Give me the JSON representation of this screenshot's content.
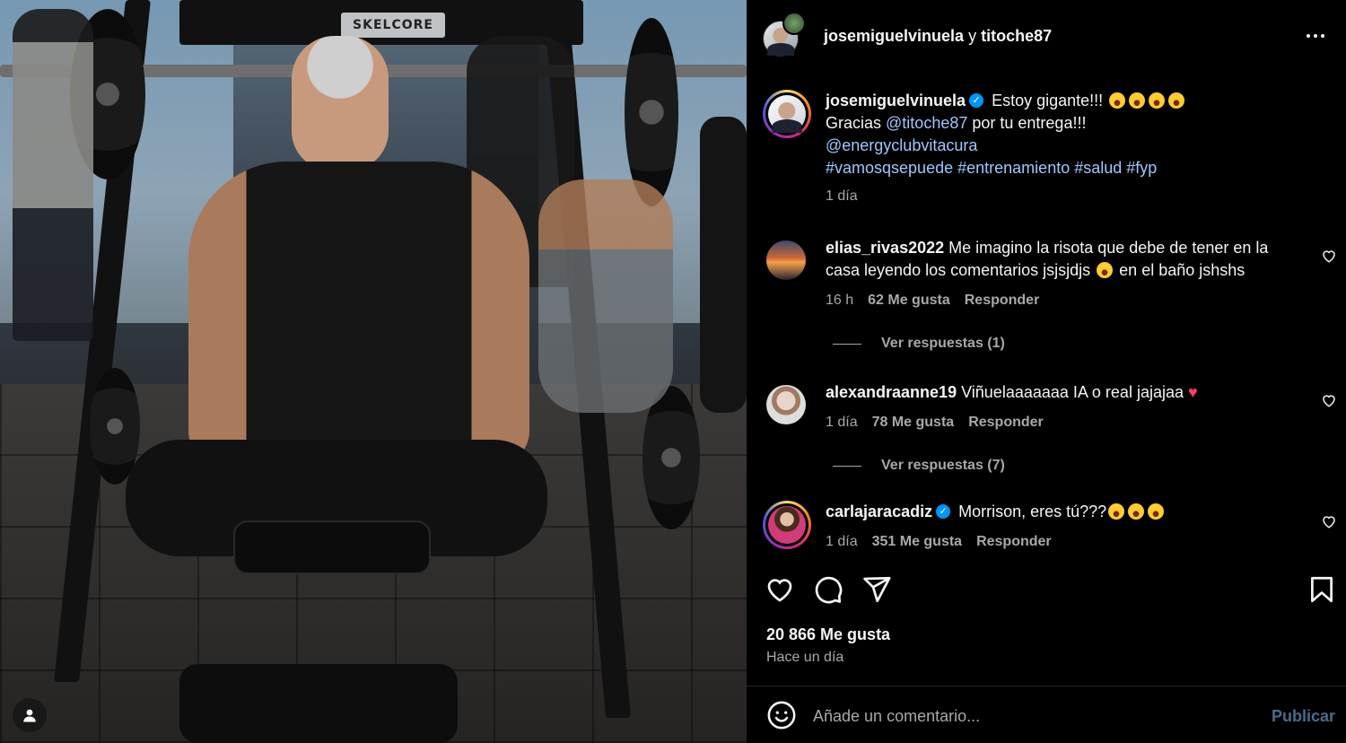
{
  "photo": {
    "brand_text": "SKELCORE"
  },
  "header": {
    "user1": "josemiguelvinuela",
    "joiner": "y",
    "user2": "titoche87"
  },
  "caption": {
    "username": "josemiguelvinuela",
    "line1_text": "Estoy gigante!!!",
    "line2_prefix": "Gracias",
    "line2_mention": "@titoche87",
    "line2_suffix": "por tu entrega!!!",
    "line3_mention": "@energyclubvitacura",
    "hashtags": [
      "#vamosqsepuede",
      "#entrenamiento",
      "#salud",
      "#fyp"
    ],
    "time": "1 día"
  },
  "comments": [
    {
      "username": "elias_rivas2022",
      "text_a": "Me imagino la risota que debe de tener en la casa leyendo los comentarios jsjsjdjs",
      "text_b": "en el baño jshshs",
      "time": "16 h",
      "likes": "62 Me gusta",
      "reply": "Responder",
      "view_replies": "Ver respuestas (1)"
    },
    {
      "username": "alexandraanne19",
      "text_a": "Viñuelaaaaaaa IA o real jajajaa",
      "time": "1 día",
      "likes": "78 Me gusta",
      "reply": "Responder",
      "view_replies": "Ver respuestas (7)"
    },
    {
      "username": "carlajaracadiz",
      "text_a": "Morrison, eres tú???",
      "time": "1 día",
      "likes": "351 Me gusta",
      "reply": "Responder"
    }
  ],
  "likes_total": "20 866 Me gusta",
  "posted": "Hace un día",
  "composer": {
    "placeholder": "Añade un comentario...",
    "publish": "Publicar"
  },
  "icons": {
    "more": "more-options-icon",
    "like": "heart-icon",
    "comment": "comment-icon",
    "share": "send-icon",
    "save": "bookmark-icon",
    "emoji": "emoji-icon",
    "verified": "verified-badge-icon",
    "user": "user-icon"
  },
  "colors": {
    "accent_link": "#9fc6ff",
    "verified": "#0095f6",
    "publish_disabled": "#4a6b8c",
    "secondary_text": "#a8a8a8"
  }
}
